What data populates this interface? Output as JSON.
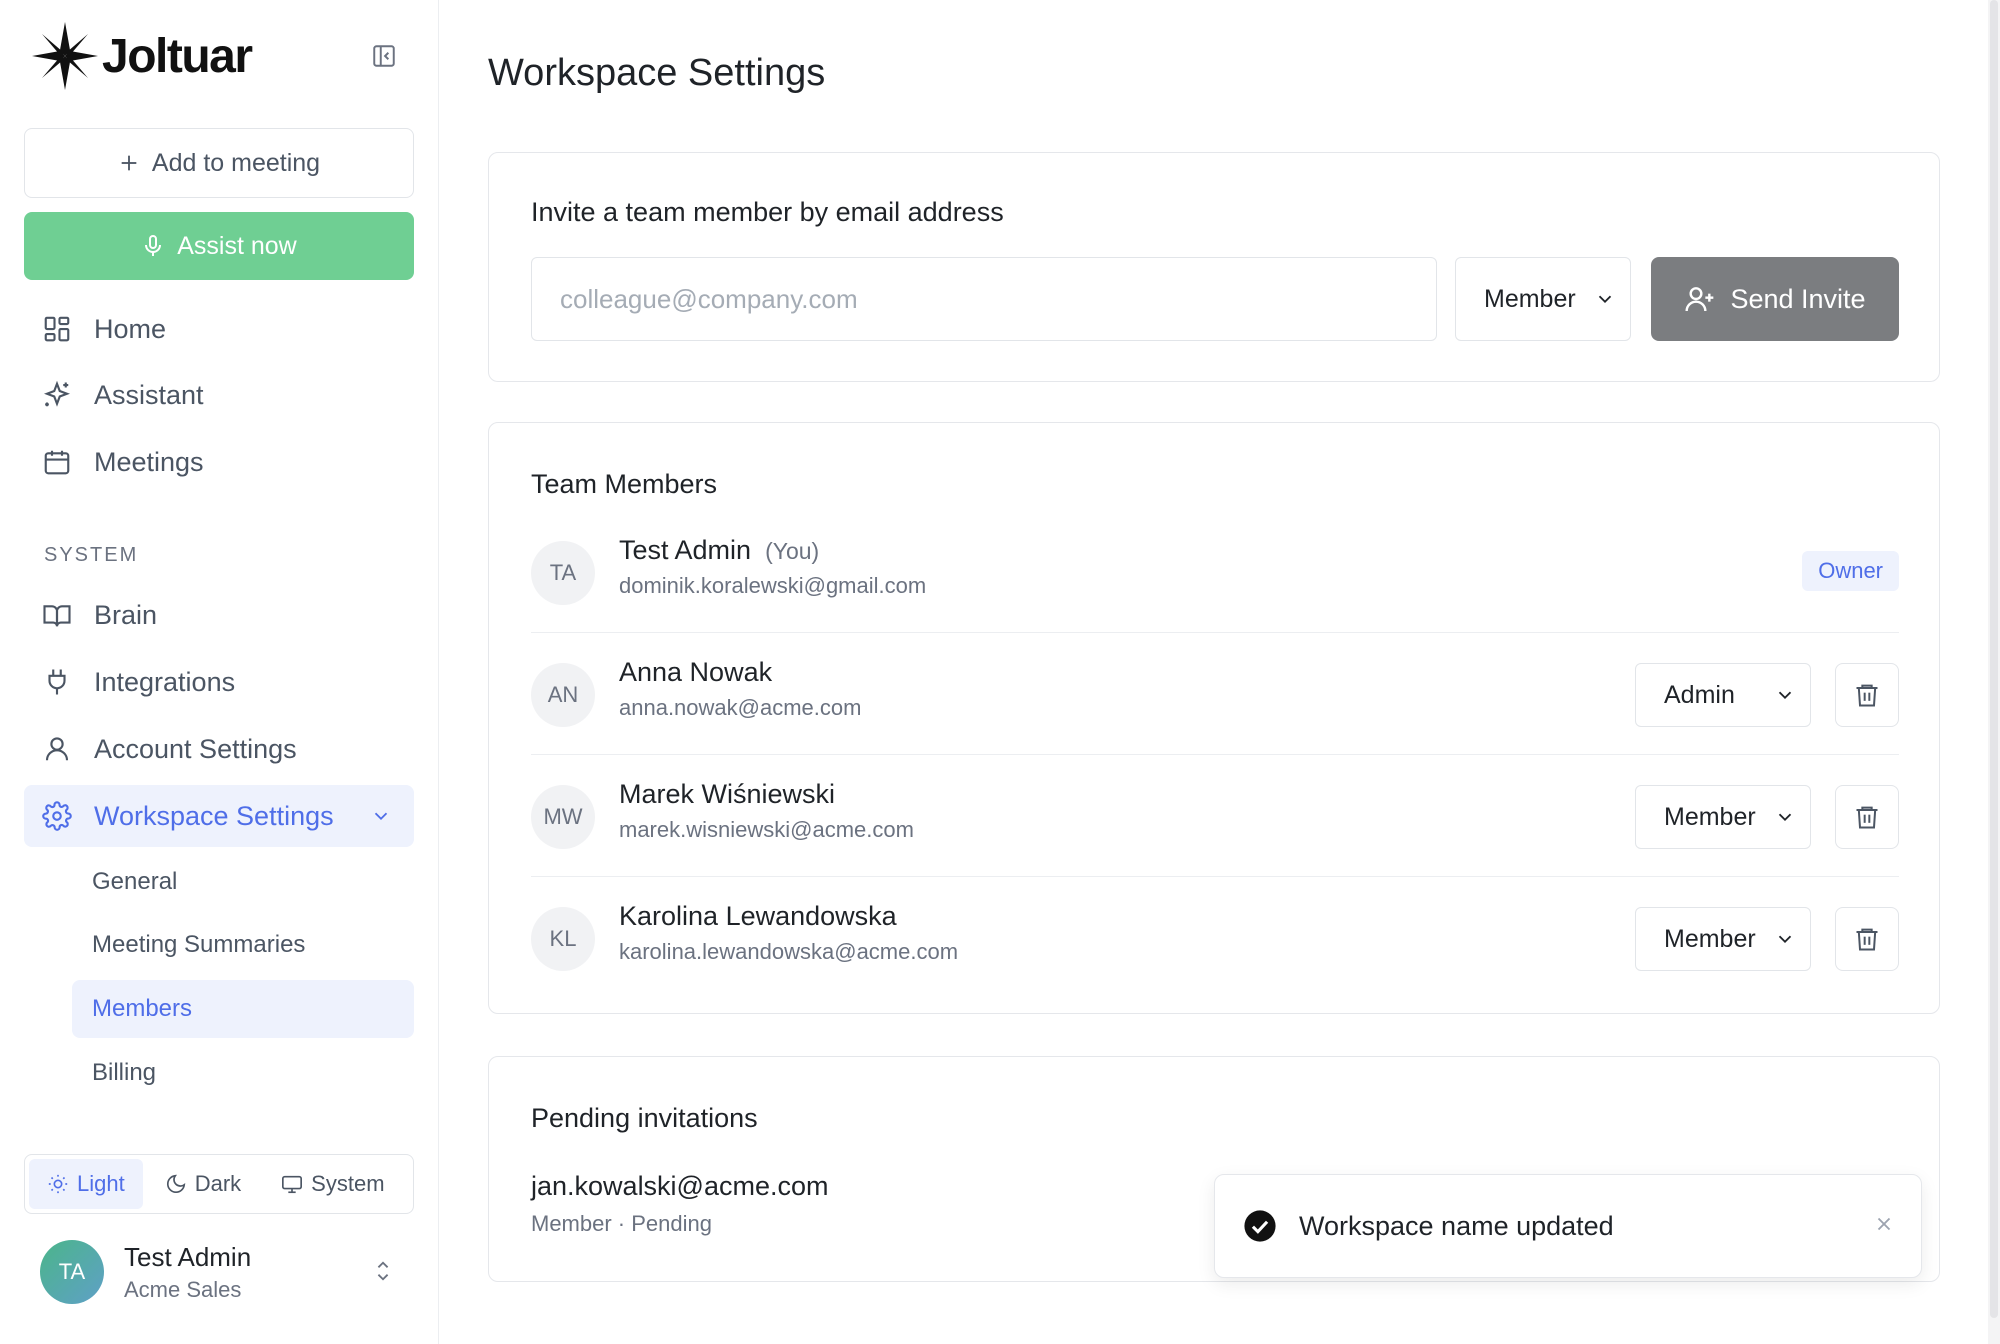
{
  "brand": {
    "name": "Joltuar"
  },
  "sidebar": {
    "add_meeting_label": "Add to meeting",
    "assist_label": "Assist now",
    "nav": [
      {
        "label": "Home",
        "icon": "grid-icon"
      },
      {
        "label": "Assistant",
        "icon": "sparkles-icon"
      },
      {
        "label": "Meetings",
        "icon": "calendar-icon"
      }
    ],
    "system_label": "SYSTEM",
    "system_nav": [
      {
        "label": "Brain",
        "icon": "book-icon"
      },
      {
        "label": "Integrations",
        "icon": "plug-icon"
      },
      {
        "label": "Account Settings",
        "icon": "user-icon"
      },
      {
        "label": "Workspace Settings",
        "icon": "gear-icon",
        "active": true
      }
    ],
    "workspace_sub": [
      {
        "label": "General"
      },
      {
        "label": "Meeting Summaries"
      },
      {
        "label": "Members",
        "active": true
      },
      {
        "label": "Billing"
      }
    ],
    "theme": {
      "light": "Light",
      "dark": "Dark",
      "system": "System",
      "selected": "Light"
    },
    "user": {
      "initials": "TA",
      "name": "Test Admin",
      "org": "Acme Sales"
    }
  },
  "main": {
    "title": "Workspace Settings",
    "invite": {
      "heading": "Invite a team member by email address",
      "placeholder": "colleague@company.com",
      "role_selected": "Member",
      "send_label": "Send Invite"
    },
    "team": {
      "heading": "Team Members",
      "members": [
        {
          "initials": "TA",
          "name": "Test Admin",
          "you_label": "(You)",
          "email": "dominik.koralewski@gmail.com",
          "role_badge": "Owner"
        },
        {
          "initials": "AN",
          "name": "Anna Nowak",
          "email": "anna.nowak@acme.com",
          "role": "Admin"
        },
        {
          "initials": "MW",
          "name": "Marek Wiśniewski",
          "email": "marek.wisniewski@acme.com",
          "role": "Member"
        },
        {
          "initials": "KL",
          "name": "Karolina Lewandowska",
          "email": "karolina.lewandowska@acme.com",
          "role": "Member"
        }
      ]
    },
    "pending": {
      "heading": "Pending invitations",
      "items": [
        {
          "email": "jan.kowalski@acme.com",
          "meta": "Member · Pending"
        }
      ]
    }
  },
  "toast": {
    "message": "Workspace name updated"
  },
  "colors": {
    "accent": "#4f6ee8",
    "accent_bg": "#eef2fd",
    "assist_green": "#6fcf93",
    "send_gray": "#7b7d80"
  }
}
